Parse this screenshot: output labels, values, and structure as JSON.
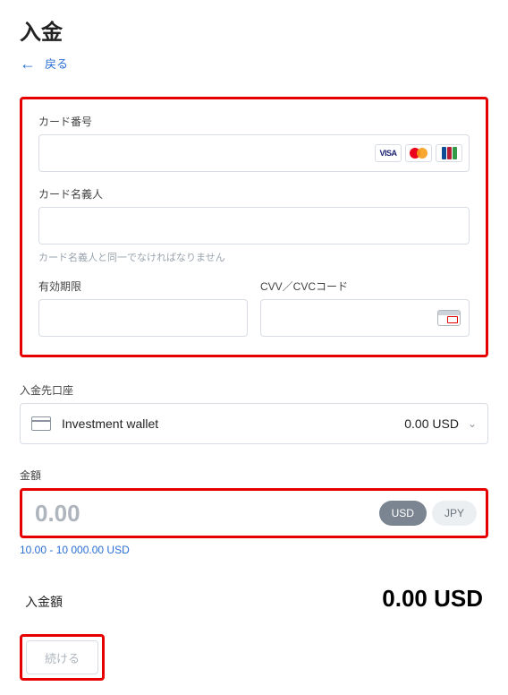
{
  "page": {
    "title": "入金",
    "back_label": "戻る"
  },
  "card": {
    "number_label": "カード番号",
    "number_value": "",
    "holder_label": "カード名義人",
    "holder_value": "",
    "holder_helper": "カード名義人と同一でなければなりません",
    "expiry_label": "有効期限",
    "expiry_value": "",
    "cvv_label": "CVV／CVCコード",
    "cvv_value": "",
    "brands": [
      "VISA",
      "Mastercard",
      "JCB"
    ]
  },
  "account": {
    "section_label": "入金先口座",
    "name": "Investment wallet",
    "balance": "0.00 USD"
  },
  "amount": {
    "section_label": "金額",
    "value": "0.00",
    "range": "10.00 - 10 000.00 USD",
    "currencies": [
      {
        "code": "USD",
        "active": true
      },
      {
        "code": "JPY",
        "active": false
      }
    ]
  },
  "summary": {
    "label": "入金額",
    "value": "0.00 USD"
  },
  "actions": {
    "continue_label": "続ける"
  }
}
